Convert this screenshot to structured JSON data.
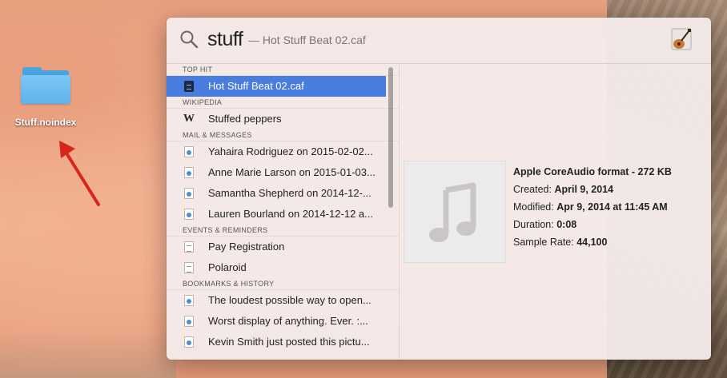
{
  "desktop": {
    "folder_label": "Stuff.noindex"
  },
  "spotlight": {
    "query": "stuff",
    "query_hint": "— Hot Stuff Beat 02.caf",
    "app_icon": "garageband-icon",
    "sections": [
      {
        "title": "TOP HIT",
        "items": [
          {
            "label": "Hot Stuff Beat 02.caf",
            "icon": "audio-file-icon",
            "selected": true
          }
        ]
      },
      {
        "title": "WIKIPEDIA",
        "items": [
          {
            "label": "Stuffed peppers",
            "icon": "wikipedia-icon"
          }
        ]
      },
      {
        "title": "MAIL & MESSAGES",
        "items": [
          {
            "label": "Yahaira Rodriguez on 2015-02-02...",
            "icon": "message-icon"
          },
          {
            "label": "Anne Marie Larson on 2015-01-03...",
            "icon": "message-icon"
          },
          {
            "label": "Samantha Shepherd on 2014-12-...",
            "icon": "message-icon"
          },
          {
            "label": "Lauren Bourland on 2014-12-12 a...",
            "icon": "message-icon"
          }
        ]
      },
      {
        "title": "EVENTS & REMINDERS",
        "items": [
          {
            "label": "Pay Registration",
            "icon": "event-icon"
          },
          {
            "label": "Polaroid",
            "icon": "event-icon"
          }
        ]
      },
      {
        "title": "BOOKMARKS & HISTORY",
        "items": [
          {
            "label": "The loudest possible way to open...",
            "icon": "bookmark-icon"
          },
          {
            "label": "Worst display of anything. Ever. :...",
            "icon": "bookmark-icon"
          },
          {
            "label": "Kevin Smith just posted this pictu...",
            "icon": "bookmark-icon"
          }
        ]
      }
    ],
    "preview": {
      "kind": "Apple CoreAudio format - 272 KB",
      "created_label": "Created:",
      "created_value": "April 9, 2014",
      "modified_label": "Modified:",
      "modified_value": "Apr 9, 2014 at 11:45 AM",
      "duration_label": "Duration:",
      "duration_value": "0:08",
      "sample_rate_label": "Sample Rate:",
      "sample_rate_value": "44,100",
      "thumb_icon": "music-note-icon"
    }
  },
  "colors": {
    "selection": "#4a7de0",
    "arrow": "#d8251c",
    "folder": "#5eb3ea"
  }
}
